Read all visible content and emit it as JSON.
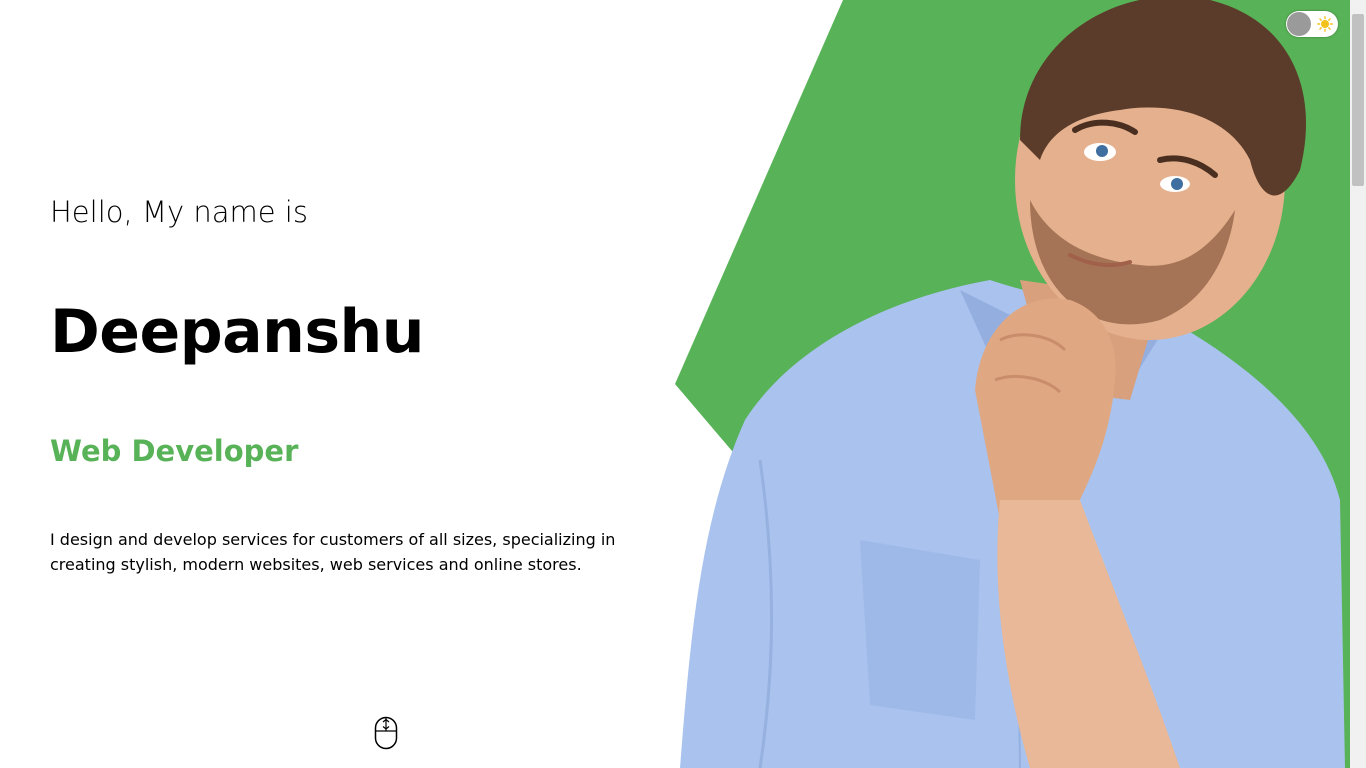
{
  "hero": {
    "greeting": "Hello, My name is",
    "name": "Deepanshu",
    "role": "Web Developer",
    "description": "I design and develop services for customers of all sizes, specializing in creating stylish, modern websites, web services and online stores."
  },
  "colors": {
    "accent": "#58b257",
    "text": "#000000",
    "background": "#ffffff"
  },
  "icons": {
    "scroll_indicator": "mouse-scroll-icon",
    "theme_toggle": "sun-icon"
  },
  "theme_toggle": {
    "mode": "light"
  }
}
